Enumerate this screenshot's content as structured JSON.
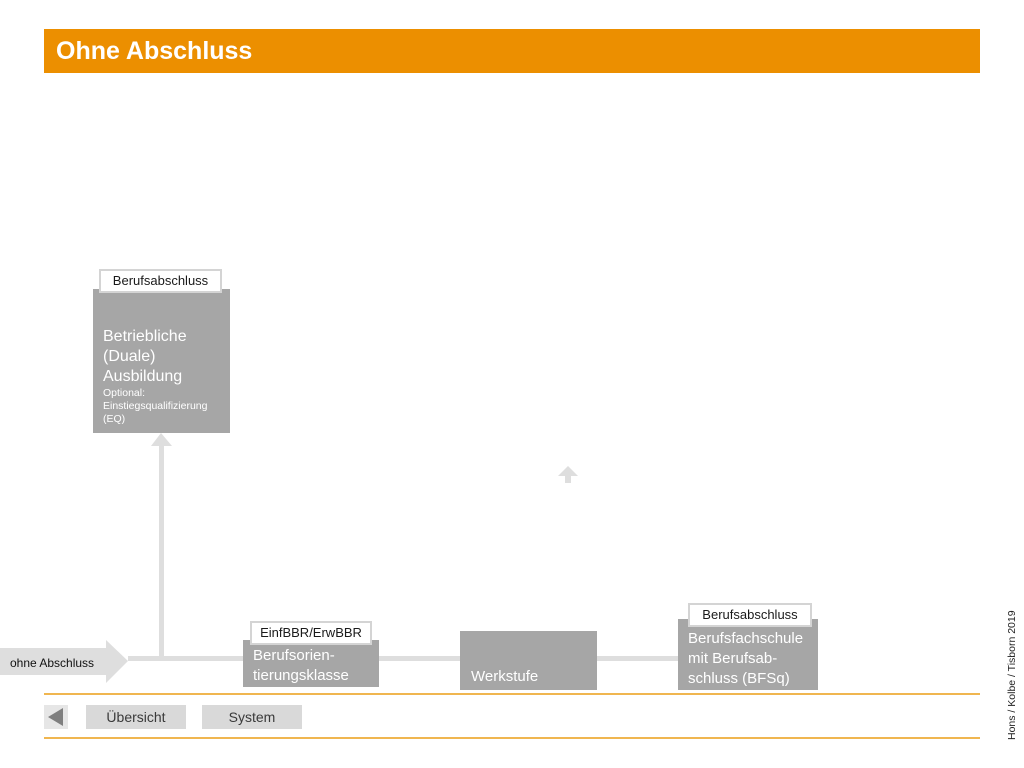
{
  "header": {
    "title": "Ohne Abschluss"
  },
  "start": {
    "label": "ohne Abschluss"
  },
  "boxes": {
    "duale": {
      "tag": "Berufsabschluss",
      "title": "Betriebliche (Duale) Ausbildung",
      "optional_label": "Optional:",
      "optional_text": "Einstiegsqualifizierung (EQ)"
    },
    "bok": {
      "tag": "EinfBBR/ErwBBR",
      "title": "Berufsorien-tierungsklasse"
    },
    "werkstufe": {
      "title": "Werkstufe"
    },
    "bfsq": {
      "tag": "Berufsabschluss",
      "title": "Berufsfachschule mit Berufsab-schluss (BFSq)"
    }
  },
  "nav": {
    "overview_label": "Übersicht",
    "system_label": "System"
  },
  "credit": "Hons / Kolbe / Tisborn 2019",
  "colors": {
    "accent": "#ec8f00",
    "box": "#a6a6a6",
    "connector": "#dedede"
  }
}
